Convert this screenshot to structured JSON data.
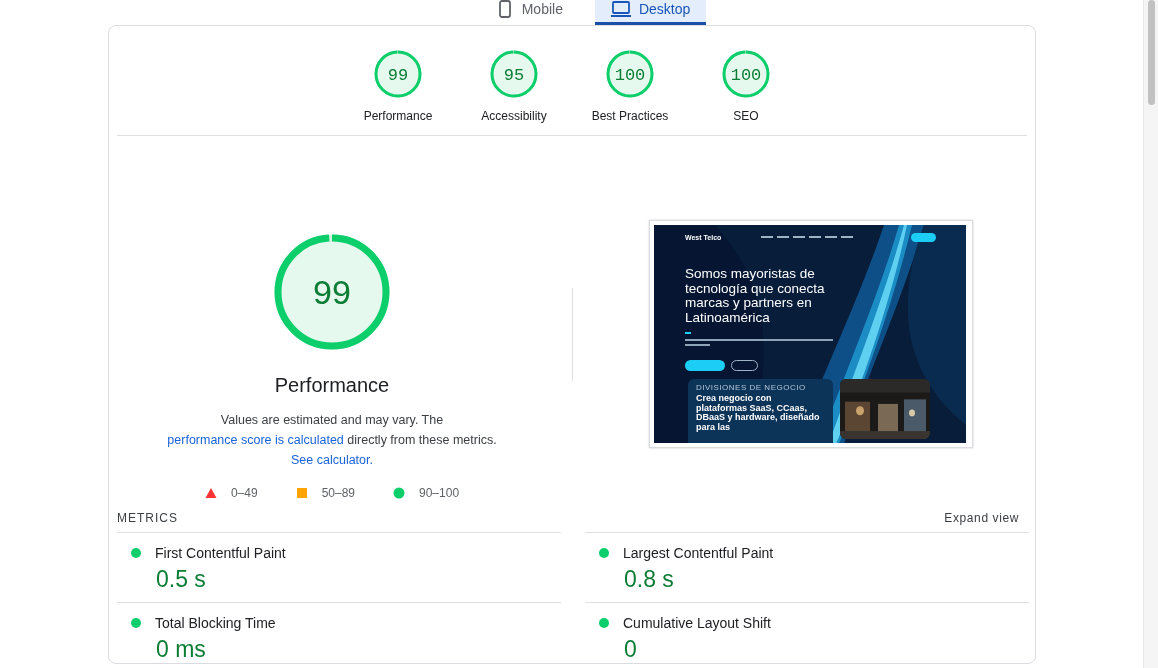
{
  "device_tabs": [
    {
      "label": "Mobile",
      "kind": "phone",
      "selected": false
    },
    {
      "label": "Desktop",
      "kind": "laptop",
      "selected": true
    }
  ],
  "score_gauges": [
    {
      "score": "99",
      "label": "Performance"
    },
    {
      "score": "95",
      "label": "Accessibility"
    },
    {
      "score": "100",
      "label": "Best Practices"
    },
    {
      "score": "100",
      "label": "SEO"
    }
  ],
  "performance": {
    "score": "99",
    "title": "Performance",
    "description": [
      {
        "kind": "text",
        "text": "Values are estimated and may vary. The "
      },
      {
        "kind": "link",
        "text": "performance score is calculated"
      },
      {
        "kind": "text",
        "text": " directly from these metrics. "
      },
      {
        "kind": "link",
        "text": "See calculator."
      }
    ],
    "legend": [
      {
        "kind": "triangle",
        "label": "0–49",
        "color": "#ff3333"
      },
      {
        "kind": "square",
        "label": "50–89",
        "color": "#ffa400"
      },
      {
        "kind": "circle",
        "label": "90–100",
        "color": "#0cce6b"
      }
    ]
  },
  "page_screenshot": {
    "brand": "West Telco",
    "headline": "Somos mayoristas de tecnología que conecta marcas y partners en Latinoamérica",
    "section_label": "DIVISIONES DE NEGOCIO",
    "card_title": "Crea negocio con plataformas SaaS, CCaas, DBaaS y hardware, diseñado para las"
  },
  "metrics": {
    "heading": "METRICS",
    "expand": "Expand view",
    "items": [
      {
        "name": "First Contentful Paint",
        "value": "0.5 s"
      },
      {
        "name": "Largest Contentful Paint",
        "value": "0.8 s"
      },
      {
        "name": "Total Blocking Time",
        "value": "0 ms"
      },
      {
        "name": "Cumulative Layout Shift",
        "value": "0"
      }
    ]
  }
}
